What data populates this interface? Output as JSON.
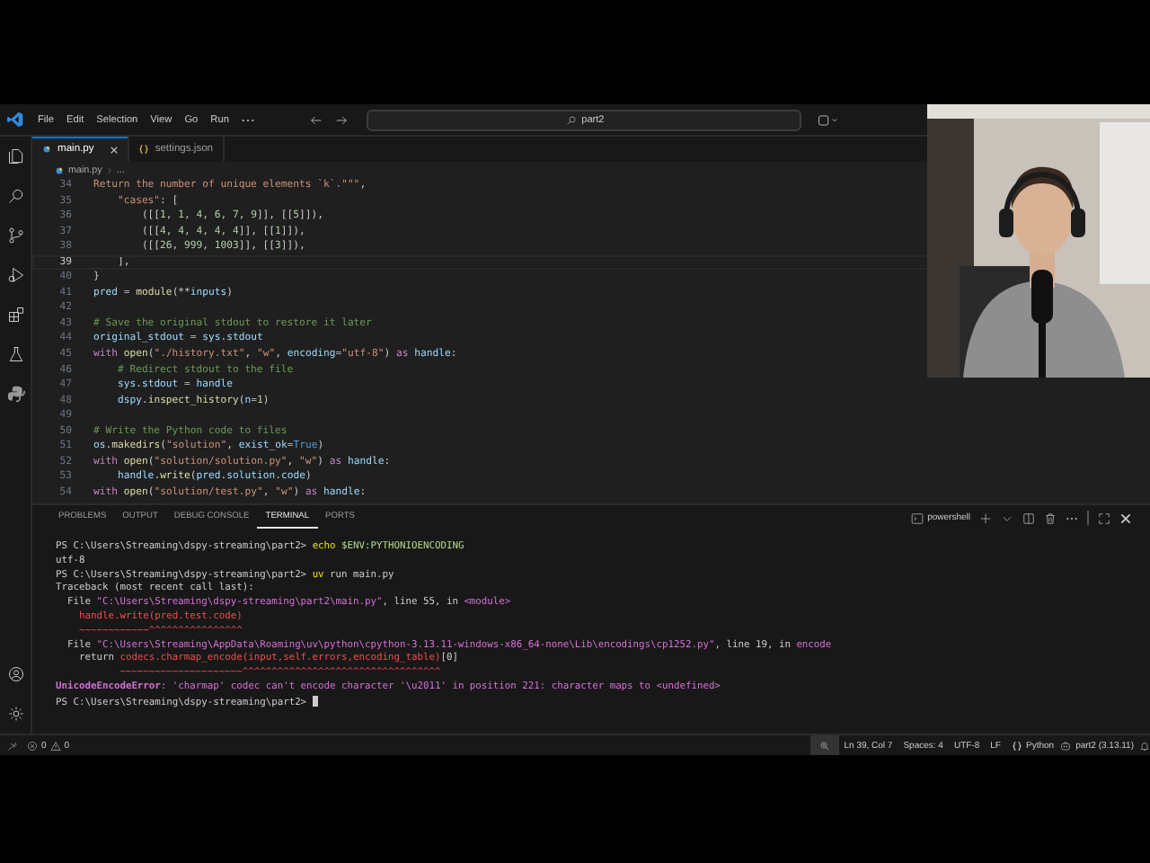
{
  "window": {
    "menu": [
      "File",
      "Edit",
      "Selection",
      "View",
      "Go",
      "Run"
    ],
    "search": {
      "value": "part2"
    }
  },
  "tabs": [
    {
      "label": "main.py",
      "kind": "python",
      "selected": true
    },
    {
      "label": "settings.json",
      "kind": "json",
      "selected": false
    }
  ],
  "breadcrumb": [
    "main.py",
    "..."
  ],
  "editor": {
    "lines": [
      {
        "number": "34",
        "current": false,
        "tokens": [
          {
            "kind": "str",
            "text": "Return the number of unique elements `k`.\"\"\""
          },
          {
            "kind": "plain",
            "text": ","
          }
        ]
      },
      {
        "number": "35",
        "current": false,
        "tokens": [
          {
            "kind": "str",
            "text": "    \"cases\""
          },
          {
            "kind": "plain",
            "text": ": ["
          }
        ]
      },
      {
        "number": "36",
        "current": false,
        "tokens": [
          {
            "kind": "plain",
            "text": "        ([["
          },
          {
            "kind": "num",
            "text": "1, 1, 4, 6, 7, 9"
          },
          {
            "kind": "plain",
            "text": "]], [["
          },
          {
            "kind": "num",
            "text": "5"
          },
          {
            "kind": "plain",
            "text": "]]),"
          }
        ]
      },
      {
        "number": "37",
        "current": false,
        "tokens": [
          {
            "kind": "plain",
            "text": "        ([["
          },
          {
            "kind": "num",
            "text": "4, 4, 4, 4, 4"
          },
          {
            "kind": "plain",
            "text": "]], [["
          },
          {
            "kind": "num",
            "text": "1"
          },
          {
            "kind": "plain",
            "text": "]]),"
          }
        ]
      },
      {
        "number": "38",
        "current": false,
        "tokens": [
          {
            "kind": "plain",
            "text": "        ([["
          },
          {
            "kind": "num",
            "text": "26, 999, 1003"
          },
          {
            "kind": "plain",
            "text": "]], [["
          },
          {
            "kind": "num",
            "text": "3"
          },
          {
            "kind": "plain",
            "text": "]]),"
          }
        ]
      },
      {
        "number": "39",
        "current": true,
        "tokens": [
          {
            "kind": "plain",
            "text": "    ],"
          }
        ]
      },
      {
        "number": "40",
        "current": false,
        "tokens": [
          {
            "kind": "plain",
            "text": "}"
          }
        ]
      },
      {
        "number": "41",
        "current": false,
        "tokens": [
          {
            "kind": "var",
            "text": "pred"
          },
          {
            "kind": "plain",
            "text": " = "
          },
          {
            "kind": "fn",
            "text": "module"
          },
          {
            "kind": "plain",
            "text": "(**"
          },
          {
            "kind": "var",
            "text": "inputs"
          },
          {
            "kind": "plain",
            "text": ")"
          }
        ]
      },
      {
        "number": "42",
        "current": false
      },
      {
        "number": "43",
        "current": false,
        "tokens": [
          {
            "kind": "comment",
            "text": "# Save the original stdout to restore it later"
          }
        ]
      },
      {
        "number": "44",
        "current": false,
        "tokens": [
          {
            "kind": "var",
            "text": "original_stdout"
          },
          {
            "kind": "plain",
            "text": " = "
          },
          {
            "kind": "var",
            "text": "sys"
          },
          {
            "kind": "plain",
            "text": "."
          },
          {
            "kind": "var",
            "text": "stdout"
          }
        ]
      },
      {
        "number": "45",
        "current": false,
        "tokens": [
          {
            "kind": "kw",
            "text": "with "
          },
          {
            "kind": "fn",
            "text": "open"
          },
          {
            "kind": "plain",
            "text": "("
          },
          {
            "kind": "str",
            "text": "\"./history.txt\""
          },
          {
            "kind": "plain",
            "text": ", "
          },
          {
            "kind": "str",
            "text": "\"w\""
          },
          {
            "kind": "plain",
            "text": ", "
          },
          {
            "kind": "var",
            "text": "encoding"
          },
          {
            "kind": "plain",
            "text": "="
          },
          {
            "kind": "str",
            "text": "\"utf-8\""
          },
          {
            "kind": "plain",
            "text": ") "
          },
          {
            "kind": "kw",
            "text": "as "
          },
          {
            "kind": "var",
            "text": "handle"
          },
          {
            "kind": "plain",
            "text": ":"
          }
        ]
      },
      {
        "number": "46",
        "current": false,
        "tokens": [
          {
            "kind": "comment",
            "text": "    # Redirect stdout to the file"
          }
        ]
      },
      {
        "number": "47",
        "current": false,
        "tokens": [
          {
            "kind": "var",
            "text": "    sys"
          },
          {
            "kind": "plain",
            "text": "."
          },
          {
            "kind": "var",
            "text": "stdout"
          },
          {
            "kind": "plain",
            "text": " = "
          },
          {
            "kind": "var",
            "text": "handle"
          }
        ]
      },
      {
        "number": "48",
        "current": false,
        "tokens": [
          {
            "kind": "var",
            "text": "    dspy"
          },
          {
            "kind": "plain",
            "text": "."
          },
          {
            "kind": "fn",
            "text": "inspect_history"
          },
          {
            "kind": "plain",
            "text": "("
          },
          {
            "kind": "var",
            "text": "n"
          },
          {
            "kind": "plain",
            "text": "="
          },
          {
            "kind": "num",
            "text": "1"
          },
          {
            "kind": "plain",
            "text": ")"
          }
        ]
      },
      {
        "number": "49",
        "current": false
      },
      {
        "number": "50",
        "current": false,
        "tokens": [
          {
            "kind": "comment",
            "text": "# Write the Python code to files"
          }
        ]
      },
      {
        "number": "51",
        "current": false,
        "tokens": [
          {
            "kind": "var",
            "text": "os"
          },
          {
            "kind": "plain",
            "text": "."
          },
          {
            "kind": "fn",
            "text": "makedirs"
          },
          {
            "kind": "plain",
            "text": "("
          },
          {
            "kind": "str",
            "text": "\"solution\""
          },
          {
            "kind": "plain",
            "text": ", "
          },
          {
            "kind": "var",
            "text": "exist_ok"
          },
          {
            "kind": "plain",
            "text": "="
          },
          {
            "kind": "const",
            "text": "True"
          },
          {
            "kind": "plain",
            "text": ")"
          }
        ]
      },
      {
        "number": "52",
        "current": false,
        "tokens": [
          {
            "kind": "kw",
            "text": "with "
          },
          {
            "kind": "fn",
            "text": "open"
          },
          {
            "kind": "plain",
            "text": "("
          },
          {
            "kind": "str",
            "text": "\"solution/solution.py\""
          },
          {
            "kind": "plain",
            "text": ", "
          },
          {
            "kind": "str",
            "text": "\"w\""
          },
          {
            "kind": "plain",
            "text": ") "
          },
          {
            "kind": "kw",
            "text": "as "
          },
          {
            "kind": "var",
            "text": "handle"
          },
          {
            "kind": "plain",
            "text": ":"
          }
        ]
      },
      {
        "number": "53",
        "current": false,
        "tokens": [
          {
            "kind": "var",
            "text": "    handle"
          },
          {
            "kind": "plain",
            "text": "."
          },
          {
            "kind": "fn",
            "text": "write"
          },
          {
            "kind": "plain",
            "text": "("
          },
          {
            "kind": "var",
            "text": "pred"
          },
          {
            "kind": "plain",
            "text": "."
          },
          {
            "kind": "var",
            "text": "solution"
          },
          {
            "kind": "plain",
            "text": "."
          },
          {
            "kind": "var",
            "text": "code"
          },
          {
            "kind": "plain",
            "text": ")"
          }
        ]
      },
      {
        "number": "54",
        "current": false,
        "tokens": [
          {
            "kind": "kw",
            "text": "with "
          },
          {
            "kind": "fn",
            "text": "open"
          },
          {
            "kind": "plain",
            "text": "("
          },
          {
            "kind": "str",
            "text": "\"solution/test.py\""
          },
          {
            "kind": "plain",
            "text": ", "
          },
          {
            "kind": "str",
            "text": "\"w\""
          },
          {
            "kind": "plain",
            "text": ") "
          },
          {
            "kind": "kw",
            "text": "as "
          },
          {
            "kind": "var",
            "text": "handle"
          },
          {
            "kind": "plain",
            "text": ":"
          }
        ]
      }
    ]
  },
  "panel": {
    "tabs": [
      {
        "label": "PROBLEMS",
        "selected": false
      },
      {
        "label": "OUTPUT",
        "selected": false
      },
      {
        "label": "DEBUG CONSOLE",
        "selected": false
      },
      {
        "label": "TERMINAL",
        "selected": true
      },
      {
        "label": "PORTS",
        "selected": false
      }
    ],
    "shell": "powershell",
    "terminal_lines": [
      {
        "tokens": [
          {
            "kind": "plain",
            "text": "PS C:\\Users\\Streaming\\dspy-streaming\\part2> "
          },
          {
            "kind": "cmd",
            "text": "echo "
          },
          {
            "kind": "arg",
            "text": "$ENV:PYTHONIOENCODING"
          }
        ]
      },
      {
        "tokens": [
          {
            "kind": "plain",
            "text": "utf-8"
          }
        ]
      },
      {
        "tokens": [
          {
            "kind": "plain",
            "text": "PS C:\\Users\\Streaming\\dspy-streaming\\part2> "
          },
          {
            "kind": "cmd",
            "text": "uv"
          },
          {
            "kind": "plain",
            "text": " run main.py"
          }
        ]
      },
      {
        "tokens": [
          {
            "kind": "plain",
            "text": "Traceback (most recent call last):"
          }
        ]
      },
      {
        "tokens": [
          {
            "kind": "plain",
            "text": "  File "
          },
          {
            "kind": "path",
            "text": "\"C:\\Users\\Streaming\\dspy-streaming\\part2\\main.py\""
          },
          {
            "kind": "plain",
            "text": ", line 55, in "
          },
          {
            "kind": "path",
            "text": "<module>"
          }
        ]
      },
      {
        "tokens": [
          {
            "kind": "err",
            "text": "    handle.write(pred.test.code)"
          }
        ]
      },
      {
        "tokens": [
          {
            "kind": "err",
            "text": "    ~~~~~~~~~~~~^^^^^^^^^^^^^^^^"
          }
        ]
      },
      {
        "tokens": [
          {
            "kind": "plain",
            "text": "  File "
          },
          {
            "kind": "path",
            "text": "\"C:\\Users\\Streaming\\AppData\\Roaming\\uv\\python\\cpython-3.13.11-windows-x86_64-none\\Lib\\encodings\\cp1252.py\""
          },
          {
            "kind": "plain",
            "text": ", line 19, in "
          },
          {
            "kind": "path",
            "text": "encode"
          }
        ]
      },
      {
        "tokens": [
          {
            "kind": "plain",
            "text": "    return "
          },
          {
            "kind": "err",
            "text": "codecs.charmap_encode(input,self.errors,encoding_table)"
          },
          {
            "kind": "plain",
            "text": "[0]"
          }
        ]
      },
      {
        "tokens": [
          {
            "kind": "err",
            "text": "           ~~~~~~~~~~~~~~~~~~~~~^^^^^^^^^^^^^^^^^^^^^^^^^^^^^^^^^^"
          }
        ]
      },
      {
        "tokens": [
          {
            "kind": "errname",
            "text": "UnicodeEncodeError"
          },
          {
            "kind": "errmsg",
            "text": ": 'charmap' codec can't encode character '\\u2011' in position 221: character maps to <undefined>"
          }
        ]
      },
      {
        "cursor": true,
        "tokens": [
          {
            "kind": "plain",
            "text": "PS C:\\Users\\Streaming\\dspy-streaming\\part2> "
          }
        ]
      }
    ]
  },
  "status_bar": {
    "errors": "0",
    "warnings": "0",
    "position": "Ln 39, Col 7",
    "indent": "Spaces: 4",
    "encoding": "UTF-8",
    "eol": "LF",
    "language": "Python",
    "interpreter": "part2 (3.13.11)"
  },
  "webcam": {
    "kind": "picture"
  }
}
